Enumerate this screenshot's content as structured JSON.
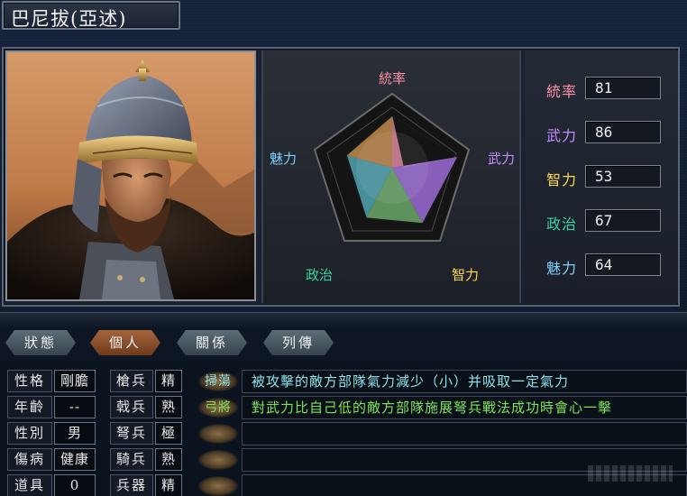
{
  "header": {
    "title": "巴尼拔(亞述)"
  },
  "portrait": {
    "alt": "portrait"
  },
  "radar": {
    "axis_labels": [
      "統率",
      "武力",
      "智力",
      "政治",
      "魅力"
    ],
    "colors": {
      "統率": "#ff8fa8",
      "武力": "#c58cff",
      "智力": "#ffd84a",
      "政治": "#38d4a0",
      "魅力": "#7fd0ff"
    }
  },
  "stats": [
    {
      "label": "統率",
      "value": "81",
      "color": "#ff8fa8"
    },
    {
      "label": "武力",
      "value": "86",
      "color": "#c58cff"
    },
    {
      "label": "智力",
      "value": "53",
      "color": "#ffd84a"
    },
    {
      "label": "政治",
      "value": "67",
      "color": "#38d4a0"
    },
    {
      "label": "魅力",
      "value": "64",
      "color": "#7fd0ff"
    }
  ],
  "tabs": [
    {
      "label": "狀態",
      "active": false
    },
    {
      "label": "個人",
      "active": true
    },
    {
      "label": "關係",
      "active": false
    },
    {
      "label": "列傳",
      "active": false
    }
  ],
  "personal": [
    {
      "label": "性格",
      "value": "剛膽"
    },
    {
      "label": "年齡",
      "value": "--"
    },
    {
      "label": "性別",
      "value": "男"
    },
    {
      "label": "傷病",
      "value": "健康"
    },
    {
      "label": "道具",
      "value": "0"
    }
  ],
  "aptitude": [
    {
      "label": "槍兵",
      "value": "精"
    },
    {
      "label": "戟兵",
      "value": "熟"
    },
    {
      "label": "弩兵",
      "value": "極"
    },
    {
      "label": "騎兵",
      "value": "熟"
    },
    {
      "label": "兵器",
      "value": "精"
    }
  ],
  "skills": [
    {
      "name": "掃蕩",
      "name_color": "#8fe3e8",
      "desc": "被攻擊的敵方部隊氣力減少（小）并吸取一定氣力",
      "desc_color": "#8fe3e8"
    },
    {
      "name": "弓將",
      "name_color": "#7fe35a",
      "desc": "對武力比自己低的敵方部隊施展弩兵戰法成功時會心一擊",
      "desc_color": "#7fe35a"
    },
    {
      "name": "",
      "name_color": "#ffffff",
      "desc": "",
      "desc_color": "#ffffff"
    },
    {
      "name": "",
      "name_color": "#ffffff",
      "desc": "",
      "desc_color": "#ffffff"
    },
    {
      "name": "",
      "name_color": "#ffffff",
      "desc": "",
      "desc_color": "#ffffff"
    }
  ]
}
